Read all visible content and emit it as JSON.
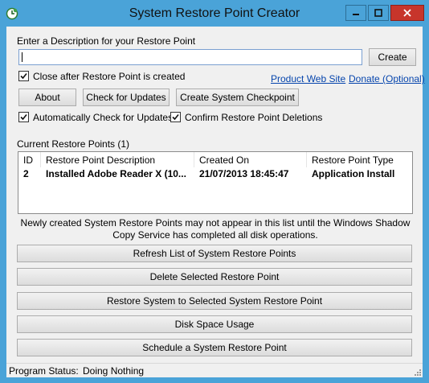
{
  "window": {
    "title": "System Restore Point Creator"
  },
  "description": {
    "label": "Enter a Description for your Restore Point",
    "value": "",
    "create_label": "Create"
  },
  "options": {
    "close_after_label": "Close after Restore Point is created",
    "close_after_checked": true,
    "auto_check_label": "Automatically Check for Updates",
    "auto_check_checked": true,
    "confirm_delete_label": "Confirm Restore Point Deletions",
    "confirm_delete_checked": true
  },
  "links": {
    "product_site": "Product Web Site",
    "donate": "Donate (Optional)"
  },
  "buttons": {
    "about": "About",
    "check_updates": "Check for Updates",
    "create_checkpoint": "Create System Checkpoint",
    "refresh": "Refresh List of System Restore Points",
    "delete": "Delete Selected Restore Point",
    "restore": "Restore System to Selected System Restore Point",
    "disk_space": "Disk Space Usage",
    "schedule": "Schedule a System Restore Point"
  },
  "list": {
    "heading": "Current Restore Points (1)",
    "columns": [
      "ID",
      "Restore Point Description",
      "Created On",
      "Restore Point Type"
    ],
    "rows": [
      {
        "id": "2",
        "description": "Installed Adobe Reader X (10...",
        "created_on": "21/07/2013 18:45:47",
        "type": "Application Install"
      }
    ]
  },
  "notice": "Newly created System Restore Points may not appear in this list until the Windows Shadow Copy Service has completed all disk operations.",
  "status": {
    "label": "Program Status:",
    "value": "Doing Nothing"
  },
  "icons": {
    "app": "restore-clock-icon",
    "minimize": "minimize-icon",
    "maximize": "maximize-icon",
    "close": "close-icon",
    "check": "checkmark-icon",
    "resize": "resize-grip-icon"
  }
}
